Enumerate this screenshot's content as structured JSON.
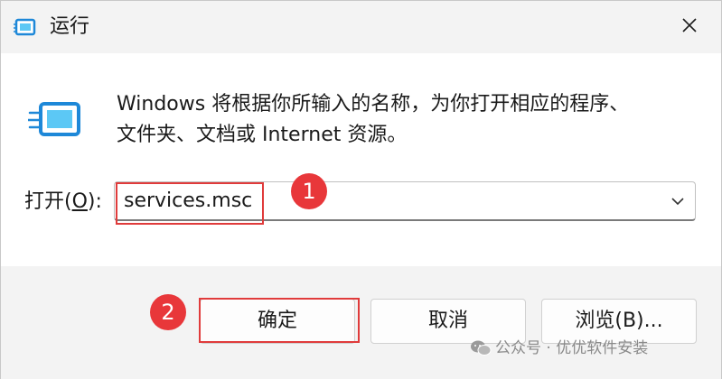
{
  "window": {
    "title": "运行",
    "close_glyph": "✕"
  },
  "content": {
    "description_line1": "Windows 将根据你所输入的名称，为你打开相应的程序、",
    "description_line2": "文件夹、文档或 Internet 资源。",
    "open_label_prefix": "打开(",
    "open_label_accel": "O",
    "open_label_suffix": "):",
    "command_value": "services.msc"
  },
  "buttons": {
    "ok": "确定",
    "cancel": "取消",
    "browse": "浏览(B)..."
  },
  "annotations": {
    "step1": "1",
    "step2": "2",
    "highlight_color": "#e03b3b",
    "badge_color": "#e8373a"
  },
  "watermark": {
    "text": "公众号 · 优优软件安装"
  },
  "icons": {
    "title": "run-dialog-icon",
    "main": "run-dialog-icon",
    "close": "close-icon",
    "dropdown": "chevron-down-icon",
    "watermark": "wechat-icon"
  }
}
